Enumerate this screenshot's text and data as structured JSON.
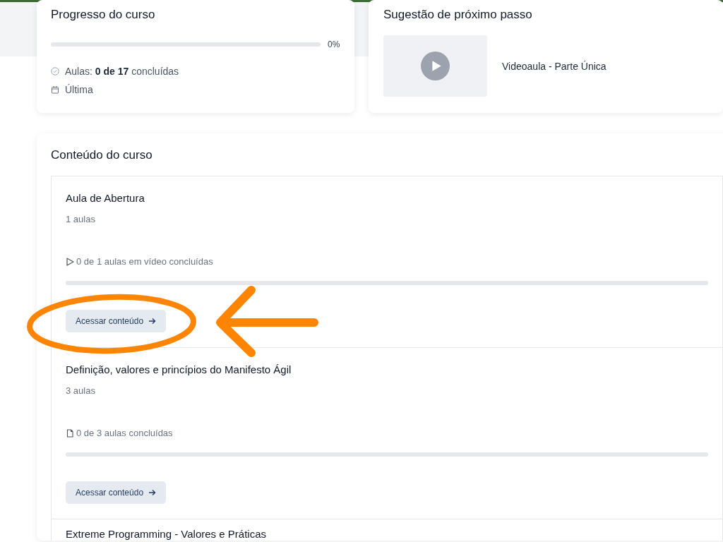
{
  "course_progress": {
    "title": "Progresso do curso",
    "level": 0,
    "percent": "0%",
    "lessons": "Aulas: **0 de 17** concluídas",
    "last_access": "Última"
  },
  "next_step": {
    "title": "Sugestão de próximo passo",
    "lesson": "Videoaula - Parte Única"
  },
  "course_content": {
    "title": "Conteúdo do curso",
    "modules": [
      {
        "title": "Aula de Abertura",
        "lesson_count": "1 aulas",
        "kind": "video",
        "progress": "0 de 1 aulas em vídeo concluídas",
        "level": 0,
        "button": "Acessar conteúdo"
      },
      {
        "title": "Definição, valores e princípios do Manifesto Ágil",
        "lesson_count": "3 aulas",
        "kind": "document",
        "progress": "0 de 3 aulas concluídas",
        "level": 0,
        "button": "Acessar conteúdo"
      },
      {
        "title": "Extreme Programming - Valores e Práticas"
      }
    ]
  }
}
